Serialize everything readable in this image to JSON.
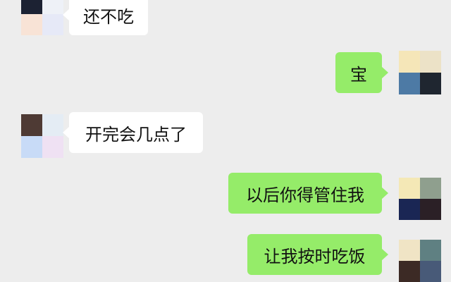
{
  "messages": [
    {
      "side": "in",
      "text": "还不吃",
      "avatar": [
        "#1c2233",
        "#eef1f7",
        "#f8e3d6",
        "#e6e9f7"
      ]
    },
    {
      "side": "out",
      "text": "宝",
      "avatar": [
        "#f5e6b8",
        "#ece2c7",
        "#4d7aa5",
        "#1f2630"
      ]
    },
    {
      "side": "in",
      "text": "开完会几点了",
      "avatar": [
        "#4e3a34",
        "#e4ecf4",
        "#c8dbf7",
        "#efe1f3"
      ]
    },
    {
      "side": "out",
      "text": "以后你得管住我",
      "avatar": [
        "#f4e8b6",
        "#8f9f8e",
        "#1a2654",
        "#2b2026"
      ]
    },
    {
      "side": "out",
      "text": "让我按时吃饭",
      "avatar": [
        "#f0e4c5",
        "#5f8082",
        "#3c2a25",
        "#485a78"
      ]
    }
  ]
}
